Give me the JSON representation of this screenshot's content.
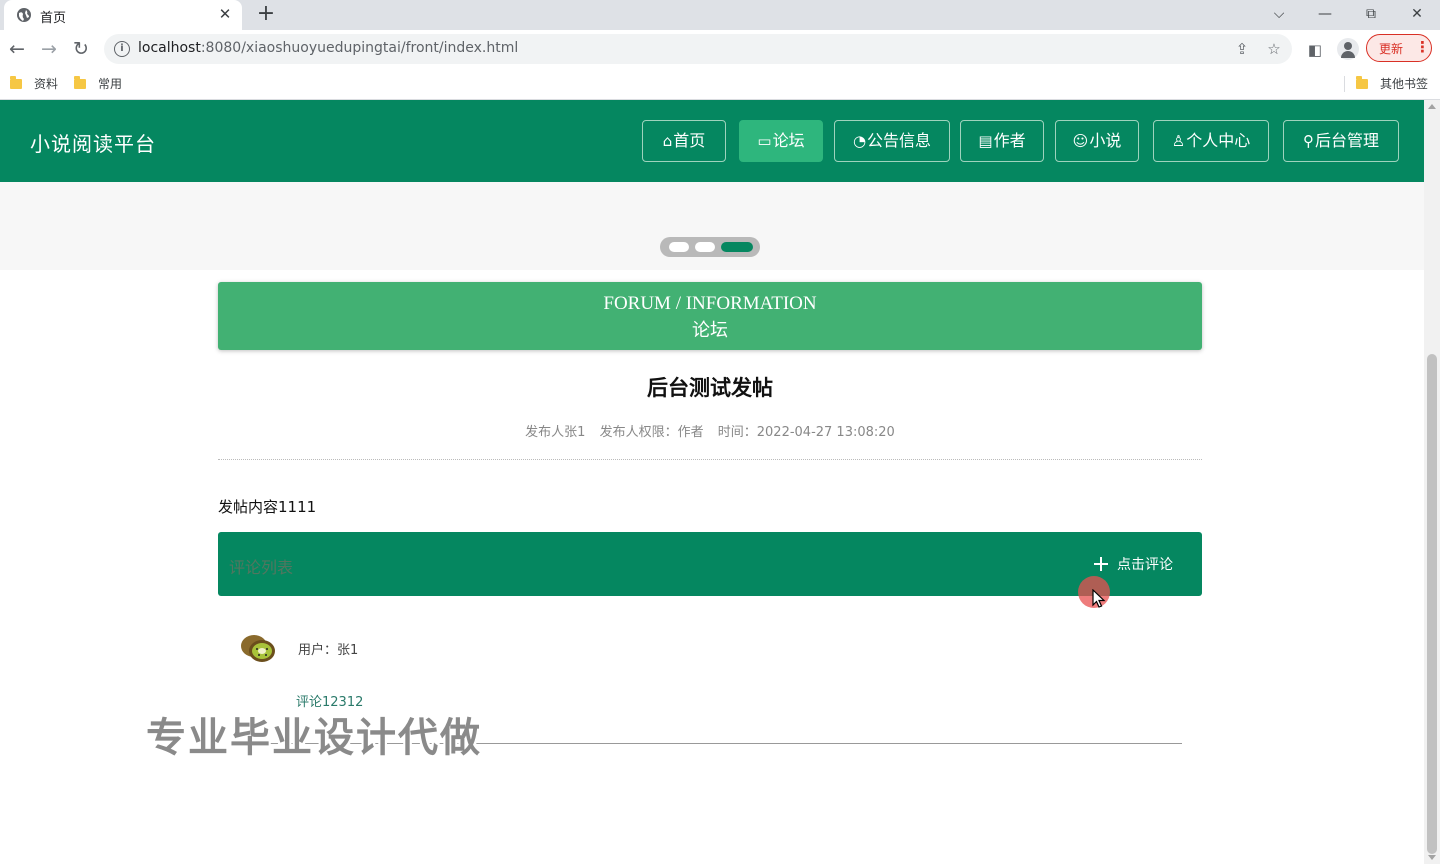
{
  "browser": {
    "tab_title": "首页",
    "tab_close": "✕",
    "new_tab": "+",
    "window_controls": {
      "chevron": "⌵",
      "minimize": "—",
      "restore": "⧉",
      "close": "✕"
    },
    "url_host": "localhost",
    "url_rest": ":8080/xiaoshuoyuedupingtai/front/index.html",
    "update_label": "更新",
    "bookmarks": [
      "资料",
      "常用"
    ],
    "other_bookmarks": "其他书签"
  },
  "site": {
    "title": "小说阅读平台",
    "nav": [
      {
        "icon": "⌂",
        "label": "首页",
        "active": false
      },
      {
        "icon": "▭",
        "label": "论坛",
        "active": true
      },
      {
        "icon": "◔",
        "label": "公告信息",
        "active": false
      },
      {
        "icon": "▤",
        "label": "作者",
        "active": false
      },
      {
        "icon": "☺",
        "label": "小说",
        "active": false
      },
      {
        "icon": "♙",
        "label": "个人中心",
        "active": false
      },
      {
        "icon": "⚲",
        "label": "后台管理",
        "active": false
      }
    ]
  },
  "section": {
    "title_en": "FORUM / INFORMATION",
    "title_cn": "论坛"
  },
  "post": {
    "title": "后台测试发帖",
    "author": "发布人张1",
    "role": "发布人权限：作者",
    "time": "时间：2022-04-27 13:08:20",
    "content": "发帖内容1111"
  },
  "comments": {
    "bar_label": "评论列表",
    "add_label": "点击评论",
    "items": [
      {
        "user": "用户：张1",
        "text": "评论12312"
      }
    ]
  },
  "watermark": "专业毕业设计代做",
  "colors": {
    "brand": "#058760",
    "active_nav": "#2eb67d",
    "section_banner": "#42b173"
  }
}
